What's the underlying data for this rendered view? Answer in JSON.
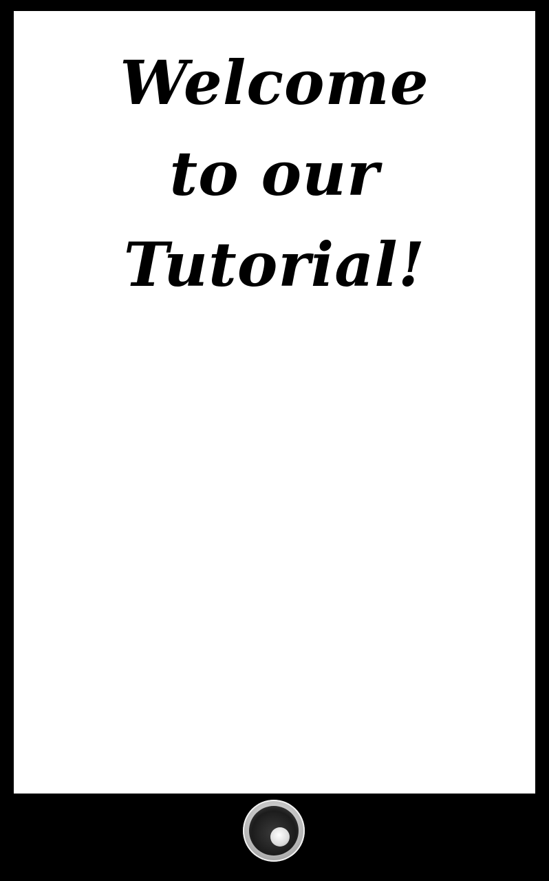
{
  "screen": {
    "title_lines": [
      "Welcome",
      "to our",
      "Tutorial!"
    ]
  },
  "device": {
    "home_button_icon": "home-button-icon",
    "bezel_color": "#000000",
    "screen_color": "#ffffff"
  }
}
